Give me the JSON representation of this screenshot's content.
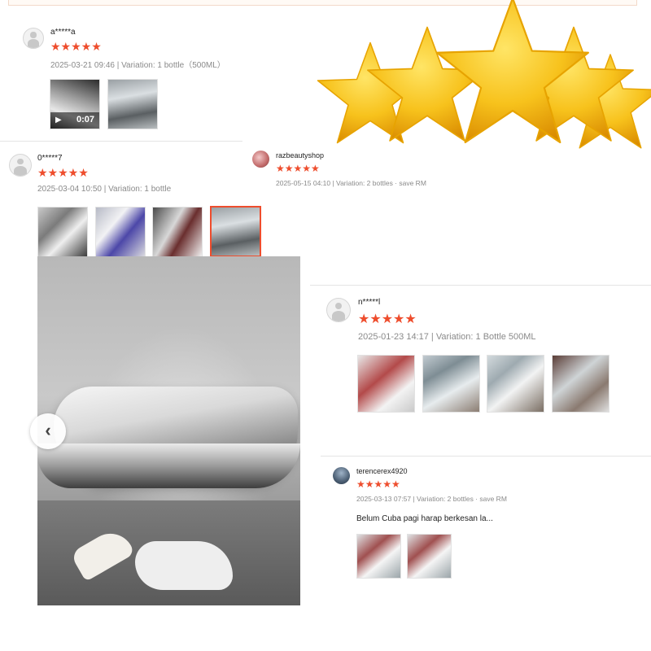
{
  "colors": {
    "star": "#ee4d2d",
    "meta": "#8a8a8a",
    "gold_star": "#f5b800"
  },
  "decoration": {
    "icon": "gold-stars-3d"
  },
  "reviews": [
    {
      "user": "a*****a",
      "stars": "★★★★★",
      "meta": "2025-03-21 09:46 | Variation: 1 bottle（500ML）",
      "video_duration": "0:07",
      "video_icon": "video-camera-icon"
    },
    {
      "user": "0*****7",
      "stars": "★★★★★",
      "meta": "2025-03-04 10:50 | Variation: 1 bottle"
    },
    {
      "user": "razbeautyshop",
      "stars": "★★★★★",
      "meta": "2025-05-15 04:10 | Variation: 2 bottles · save RM"
    },
    {
      "user": "n*****l",
      "stars": "★★★★★",
      "meta": "2025-01-23 14:17 | Variation: 1 Bottle 500ML"
    },
    {
      "user": "terencerex4920",
      "stars": "★★★★★",
      "meta": "2025-03-13 07:57 | Variation: 2 bottles · save RM",
      "comment": "Belum Cuba pagi harap berkesan la..."
    }
  ],
  "viewer": {
    "prev_icon": "chevron-left-icon",
    "prev_glyph": "‹"
  }
}
